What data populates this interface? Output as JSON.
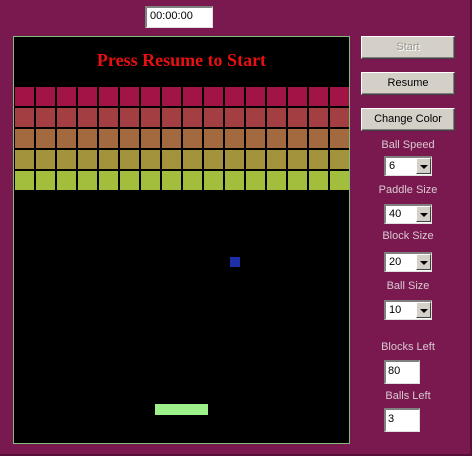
{
  "timer": {
    "value": "00:00:00"
  },
  "game": {
    "message": "Press Resume to Start",
    "ball_color": "#1e2ea8",
    "paddle_color": "#9ef08a",
    "field_color": "#000000",
    "block_rows": [
      {
        "color": "#a31446"
      },
      {
        "color": "#a33e43"
      },
      {
        "color": "#a3693f"
      },
      {
        "color": "#a3933c"
      },
      {
        "color": "#a3bd3c"
      }
    ],
    "blocks_per_row": 16
  },
  "controls": {
    "start_label": "Start",
    "resume_label": "Resume",
    "change_color_label": "Change Color",
    "ball_speed": {
      "label": "Ball Speed",
      "value": "6"
    },
    "paddle_size": {
      "label": "Paddle Size",
      "value": "40"
    },
    "block_size": {
      "label": "Block Size",
      "value": "20"
    },
    "ball_size": {
      "label": "Ball Size",
      "value": "10"
    },
    "blocks_left": {
      "label": "Blocks Left",
      "value": "80"
    },
    "balls_left": {
      "label": "Balls Left",
      "value": "3"
    }
  }
}
